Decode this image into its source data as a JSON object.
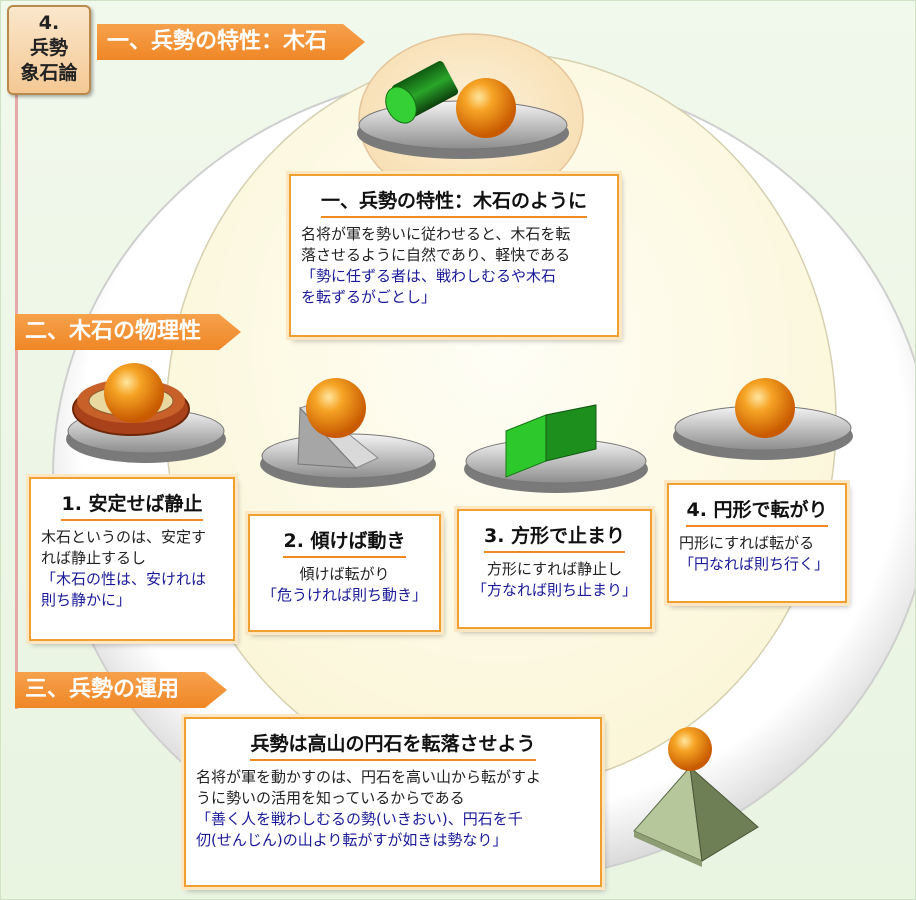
{
  "corner": {
    "line1": "4.",
    "line2": "兵勢",
    "line3": "象石論"
  },
  "banners": {
    "b1": "一、兵勢の特性：木石",
    "b2": "二、木石の物理性",
    "b3": "三、兵勢の運用"
  },
  "main_box": {
    "title": "一、兵勢の特性：木石のように",
    "body1": "名将が軍を勢いに従わせると、木石を転",
    "body2": "落させるように自然であり、軽快である",
    "quote1": "「勢に任ずる者は、戦わしむるや木石",
    "quote2": "を転ずるがごとし」"
  },
  "boxes": [
    {
      "title": "1. 安定せば静止",
      "body1": "木石というのは、安定す",
      "body2": "れば静止するし",
      "quote1": "「木石の性は、安けれは",
      "quote2": "則ち静かに」"
    },
    {
      "title": "2. 傾けば動き",
      "body1": "傾けば転がり",
      "quote1": "「危うければ則ち動き」"
    },
    {
      "title": "3. 方形で止まり",
      "body1": "方形にすれば静止し",
      "quote1": "「方なれば則ち止まり」"
    },
    {
      "title": "4. 円形で転がり",
      "body1": "円形にすれば転がる",
      "quote1": "「円なれば則ち行く」"
    }
  ],
  "bottom_box": {
    "title": "兵勢は高山の円石を転落させよう",
    "body1": "名将が軍を動かすのは、円石を高い山から転がすよ",
    "body2": "うに勢いの活用を知っているからである",
    "quote1": "「善く人を戦わしむるの勢(いきおい)、円石を千",
    "quote2": "仞(せんじん)の山より転がすが如きは勢なり」"
  },
  "colors": {
    "banner": "#ef8a2a",
    "box_border": "#f0a030",
    "quote_text": "#1a1a9a",
    "ball": "#f29418",
    "cylinder": "#1f9a1f",
    "cube": "#2fcf2f"
  }
}
